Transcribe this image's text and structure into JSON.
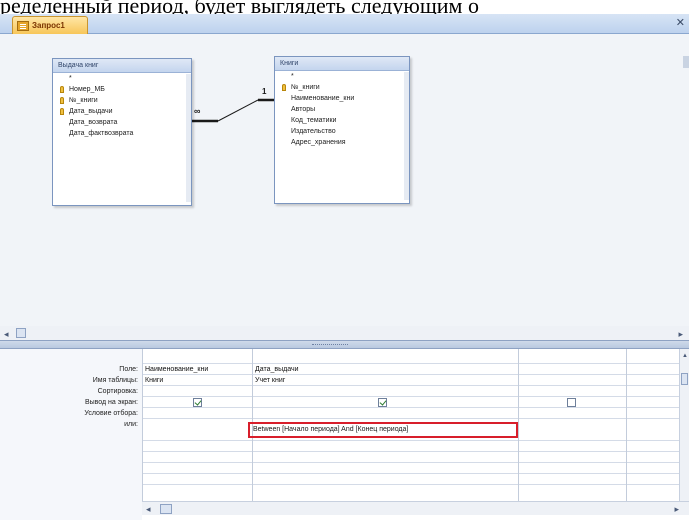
{
  "caption": "ределенный период, будет выглядеть следующим о",
  "tab": {
    "label": "Запрос1",
    "close": "✕"
  },
  "tables": {
    "issue": {
      "title": "Выдача книг",
      "fields": [
        "*",
        "Номер_МБ",
        "№_книги",
        "Дата_выдачи",
        "Дата_возврата",
        "Дата_фактвозврата"
      ],
      "key_fields": [
        1,
        2,
        3
      ]
    },
    "book": {
      "title": "Книги",
      "fields": [
        "*",
        "№_книги",
        "Наименование_кни",
        "Авторы",
        "Код_тематики",
        "Издательство",
        "Адрес_хранения"
      ],
      "key_fields": [
        1
      ]
    }
  },
  "relation": {
    "many_symbol": "∞",
    "one_symbol": "1"
  },
  "grid": {
    "row_labels": [
      "Поле:",
      "Имя таблицы:",
      "Сортировка:",
      "Вывод на экран:",
      "Условие отбора:",
      "или:"
    ],
    "columns": [
      {
        "field": "Наименование_кни",
        "table": "Книги",
        "show": true,
        "criteria": ""
      },
      {
        "field": "Дата_выдачи",
        "table": "Учет книг",
        "show": true,
        "criteria": "Between [Начало периода] And [Конец периода]"
      },
      {
        "field": "",
        "table": "",
        "show": false,
        "criteria": ""
      }
    ]
  },
  "colors": {
    "highlight_border": "#d81e2b",
    "tab_accent": "#f7c65a"
  }
}
